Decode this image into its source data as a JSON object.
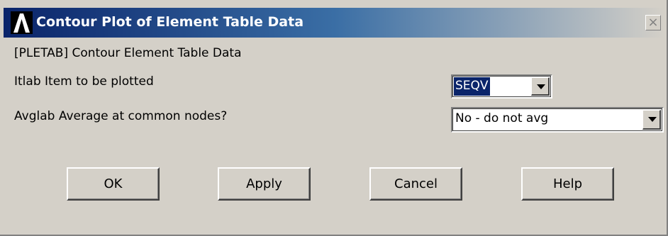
{
  "window": {
    "title": "Contour Plot of Element Table Data",
    "close_glyph": "×"
  },
  "header": {
    "command": "[PLETAB]  Contour Element Table Data"
  },
  "fields": {
    "itlab": {
      "label": "Itlab   Item to be plotted",
      "value": "SEQV"
    },
    "avglab": {
      "label": "Avglab  Average at common nodes?",
      "value": "No  - do not avg"
    }
  },
  "buttons": {
    "ok": "OK",
    "apply": "Apply",
    "cancel": "Cancel",
    "help": "Help"
  },
  "colors": {
    "title_gradient_start": "#0a246a",
    "selection": "#0a246a",
    "dialog_bg": "#d4d0c8"
  },
  "icons": {
    "app_logo": "ansys-logo-icon",
    "close": "close-icon",
    "dropdown": "chevron-down-icon"
  }
}
